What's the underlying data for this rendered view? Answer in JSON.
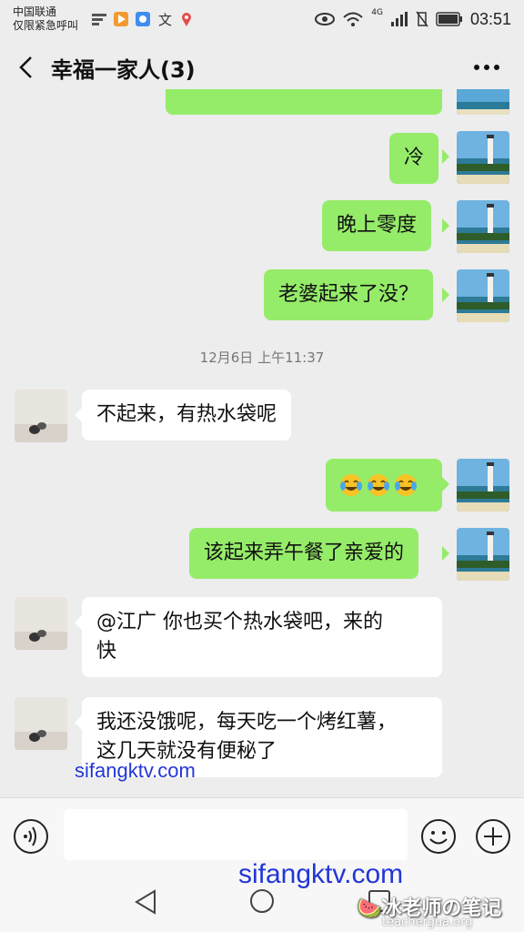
{
  "status_bar": {
    "carrier_line1": "中国联通",
    "carrier_line2": "仅限紧急呼叫",
    "network": "4G",
    "time": "03:51"
  },
  "header": {
    "title": "幸福一家人(3)",
    "back_icon": "chevron-left-icon",
    "more_icon": "more-dots-icon"
  },
  "messages": [
    {
      "sender": "me",
      "text": "冷"
    },
    {
      "sender": "me",
      "text": "晚上零度"
    },
    {
      "sender": "me",
      "text": "老婆起来了没？"
    },
    {
      "sender": "them",
      "text": "不起来，有热水袋呢"
    },
    {
      "sender": "me",
      "text": "",
      "emojis": [
        "tears-of-joy",
        "tears-of-joy",
        "tears-of-joy"
      ]
    },
    {
      "sender": "me",
      "text": "该起来弄午餐了亲爱的"
    },
    {
      "sender": "them",
      "line1": "@江广  你也买个热水袋吧，来的",
      "line2": "快"
    },
    {
      "sender": "them",
      "line1": "我还没饿呢，每天吃一个烤红薯，",
      "line2": "这几天就没有便秘了"
    }
  ],
  "timestamp": "12月6日 上午11:37",
  "watermarks": {
    "wm1": "sifangktv.com",
    "wm2": "sifangktv.com",
    "wm3": "🍉冰老师の笔记",
    "wm4": "teachergua.org"
  },
  "input_bar": {
    "value": "",
    "voice_icon": "voice-icon",
    "emoji_icon": "emoji-icon",
    "plus_icon": "plus-icon"
  },
  "colors": {
    "my_bubble": "#95ec69",
    "their_bubble": "#ffffff",
    "background": "#ededed"
  }
}
